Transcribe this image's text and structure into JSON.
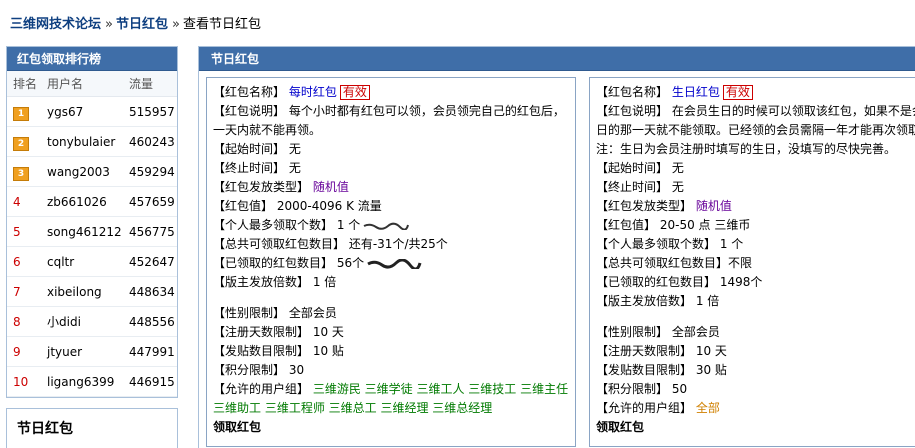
{
  "breadcrumb": {
    "forum": "三维网技术论坛",
    "section": "节日红包",
    "sep": "»",
    "current": "查看节日红包"
  },
  "ranking": {
    "title": "红包领取排行榜",
    "col_rank": "排名",
    "col_user": "用户名",
    "col_flow": "流量",
    "rows": [
      {
        "rank": "1",
        "user": "ygs67",
        "flow": "515957"
      },
      {
        "rank": "2",
        "user": "tonybulaier",
        "flow": "460243"
      },
      {
        "rank": "3",
        "user": "wang2003",
        "flow": "459294"
      },
      {
        "rank": "4",
        "user": "zb661026",
        "flow": "457659"
      },
      {
        "rank": "5",
        "user": "song461212",
        "flow": "456775"
      },
      {
        "rank": "6",
        "user": "cqltr",
        "flow": "452647"
      },
      {
        "rank": "7",
        "user": "xibeilong",
        "flow": "448634"
      },
      {
        "rank": "8",
        "user": "小didi",
        "flow": "448556"
      },
      {
        "rank": "9",
        "user": "jtyuer",
        "flow": "447991"
      },
      {
        "rank": "10",
        "user": "ligang6399",
        "flow": "446915"
      }
    ]
  },
  "holiday_panel": {
    "title": "节日红包"
  },
  "main": {
    "title": "节日红包"
  },
  "card1": {
    "name_label": "【红包名称】",
    "name": "每时红包",
    "status": "有效",
    "desc_label": "【红包说明】",
    "desc": "每个小时都有红包可以领，会员领完自己的红包后，一天内就不能再领。",
    "start_label": "【起始时间】",
    "start": "无",
    "end_label": "【终止时间】",
    "end": "无",
    "type_label": "【红包发放类型】",
    "type": "随机值",
    "value_label": "【红包值】",
    "value": "2000-4096 K 流量",
    "max_label": "【个人最多领取个数】",
    "max": "1 个",
    "total_label": "【总共可领取红包数目】",
    "total": "还有-31个/共25个",
    "claimed_label": "【已领取的红包数目】",
    "claimed": "56个",
    "mult_label": "【版主发放倍数】",
    "mult": "1 倍",
    "gender_label": "【性别限制】",
    "gender": "全部会员",
    "regdays_label": "【注册天数限制】",
    "regdays": "10 天",
    "posts_label": "【发贴数目限制】",
    "posts": "10 贴",
    "points_label": "【积分限制】",
    "points": "30",
    "groups_label": "【允许的用户组】",
    "groups": "三维游民 三维学徒 三维工人 三维技工 三维主任 三维助工 三维工程师 三维总工 三维经理 三维总经理",
    "claim": "领取红包"
  },
  "card2": {
    "name_label": "【红包名称】",
    "name": "生日红包",
    "status": "有效",
    "desc_label": "【红包说明】",
    "desc": "在会员生日的时候可以领取该红包，如果不是会员生日的那一天就不能领取。已经领的会员需隔一年才能再次领取。",
    "note": "注：生日为会员注册时填写的生日，没填写的尽快完善。",
    "start_label": "【起始时间】",
    "start": "无",
    "end_label": "【终止时间】",
    "end": "无",
    "type_label": "【红包发放类型】",
    "type": "随机值",
    "value_label": "【红包值】",
    "value": "20-50 点  三维币",
    "max_label": "【个人最多领取个数】",
    "max": "1 个",
    "total_label": "【总共可领取红包数目】",
    "total": "不限",
    "claimed_label": "【已领取的红包数目】",
    "claimed": "1498个",
    "mult_label": "【版主发放倍数】",
    "mult": "1 倍",
    "gender_label": "【性别限制】",
    "gender": "全部会员",
    "regdays_label": "【注册天数限制】",
    "regdays": "10 天",
    "posts_label": "【发贴数目限制】",
    "posts": "30 贴",
    "points_label": "【积分限制】",
    "points": "50",
    "groups_label": "【允许的用户组】",
    "groups": "全部",
    "claim": "领取红包"
  }
}
